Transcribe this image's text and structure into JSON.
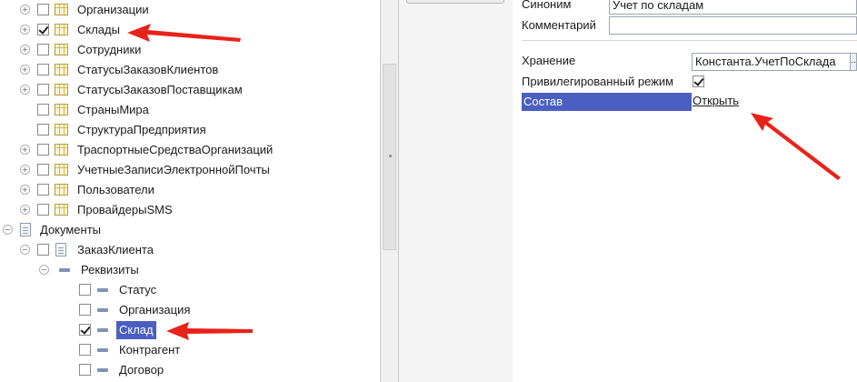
{
  "tree": {
    "catalogs": [
      {
        "label": "Организации",
        "checked": false
      },
      {
        "label": "Склады",
        "checked": true
      },
      {
        "label": "Сотрудники",
        "checked": false
      },
      {
        "label": "СтатусыЗаказовКлиентов",
        "checked": false
      },
      {
        "label": "СтатусыЗаказовПоставщикам",
        "checked": false
      },
      {
        "label": "СтраныМира",
        "checked": false
      },
      {
        "label": "СтруктураПредприятия",
        "checked": false
      },
      {
        "label": "ТраспортныеСредстваОрганизаций",
        "checked": false
      },
      {
        "label": "УчетныеЗаписиЭлектроннойПочты",
        "checked": false
      },
      {
        "label": "Пользователи",
        "checked": false
      },
      {
        "label": "ПровайдерыSMS",
        "checked": false
      }
    ],
    "documents_label": "Документы",
    "document_item": "ЗаказКлиента",
    "requisites_label": "Реквизиты",
    "requisites": [
      {
        "label": "Статус",
        "checked": false
      },
      {
        "label": "Организация",
        "checked": false
      },
      {
        "label": "Склад",
        "checked": true,
        "selected": true
      },
      {
        "label": "Контрагент",
        "checked": false
      },
      {
        "label": "Договор",
        "checked": false
      }
    ]
  },
  "properties": {
    "synonym_label": "Синоним",
    "synonym_value": "Учет по складам",
    "comment_label": "Комментарий",
    "comment_value": "",
    "storage_label": "Хранение",
    "storage_value": "Константа.УчетПоСклада",
    "storage_button": "..",
    "privileged_label": "Привилегированный режим",
    "privileged_checked": true,
    "composition_label": "Состав",
    "composition_link": "Открыть"
  },
  "colors": {
    "selection": "#4a5fc1",
    "annotation_arrow": "#e8231a"
  }
}
